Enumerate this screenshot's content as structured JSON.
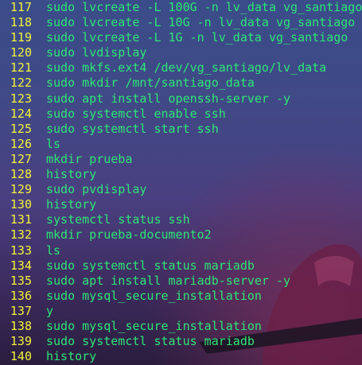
{
  "colors": {
    "line_number": "#f2f23a",
    "command_text": "#2ee577",
    "background_top": "#3a4c8a",
    "background_bottom": "#2a1d3e"
  },
  "history": [
    {
      "num": "117",
      "cmd": "sudo lvcreate -L 100G -n lv_data vg_santiago"
    },
    {
      "num": "118",
      "cmd": "sudo lvcreate -L 10G -n lv_data vg_santiago"
    },
    {
      "num": "119",
      "cmd": "sudo lvcreate -L 1G -n lv_data vg_santiago"
    },
    {
      "num": "120",
      "cmd": "sudo lvdisplay"
    },
    {
      "num": "121",
      "cmd": "sudo mkfs.ext4 /dev/vg_santiago/lv_data"
    },
    {
      "num": "122",
      "cmd": "sudo mkdir /mnt/santiago_data"
    },
    {
      "num": "123",
      "cmd": "sudo apt install openssh-server -y"
    },
    {
      "num": "124",
      "cmd": "sudo systemctl enable ssh"
    },
    {
      "num": "125",
      "cmd": "sudo systemctl start ssh"
    },
    {
      "num": "126",
      "cmd": "ls"
    },
    {
      "num": "127",
      "cmd": "mkdir prueba"
    },
    {
      "num": "128",
      "cmd": "history"
    },
    {
      "num": "129",
      "cmd": "sudo pvdisplay"
    },
    {
      "num": "130",
      "cmd": "history"
    },
    {
      "num": "131",
      "cmd": "systemctl status ssh"
    },
    {
      "num": "132",
      "cmd": "mkdir prueba-documento2"
    },
    {
      "num": "133",
      "cmd": "ls"
    },
    {
      "num": "134",
      "cmd": "sudo systemctl status mariadb"
    },
    {
      "num": "135",
      "cmd": "sudo apt install mariadb-server -y"
    },
    {
      "num": "136",
      "cmd": "sudo mysql_secure_installation"
    },
    {
      "num": "137",
      "cmd": "y"
    },
    {
      "num": "138",
      "cmd": "sudo mysql_secure_installation"
    },
    {
      "num": "139",
      "cmd": "sudo systemctl status mariadb"
    },
    {
      "num": "140",
      "cmd": "history"
    }
  ]
}
